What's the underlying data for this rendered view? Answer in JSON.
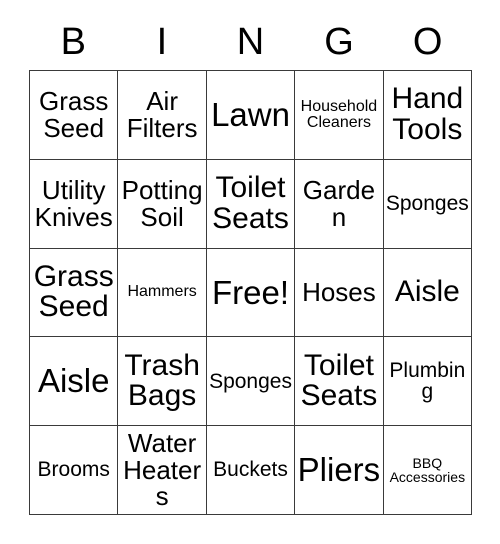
{
  "card": {
    "header_letters": [
      "B",
      "I",
      "N",
      "G",
      "O"
    ],
    "rows": [
      [
        {
          "text": "Grass Seed",
          "size": "md"
        },
        {
          "text": "Air Filters",
          "size": "md"
        },
        {
          "text": "Lawn",
          "size": "xl"
        },
        {
          "text": "Household Cleaners",
          "size": "xs"
        },
        {
          "text": "Hand Tools",
          "size": "lg"
        }
      ],
      [
        {
          "text": "Utility Knives",
          "size": "md"
        },
        {
          "text": "Potting Soil",
          "size": "md"
        },
        {
          "text": "Toilet Seats",
          "size": "lg"
        },
        {
          "text": "Garden",
          "size": "md"
        },
        {
          "text": "Sponges",
          "size": "sm"
        }
      ],
      [
        {
          "text": "Grass Seed",
          "size": "lg"
        },
        {
          "text": "Hammers",
          "size": "xs"
        },
        {
          "text": "Free!",
          "size": "xl"
        },
        {
          "text": "Hoses",
          "size": "md"
        },
        {
          "text": "Aisle",
          "size": "lg"
        }
      ],
      [
        {
          "text": "Aisle",
          "size": "xl"
        },
        {
          "text": "Trash Bags",
          "size": "lg"
        },
        {
          "text": "Sponges",
          "size": "sm"
        },
        {
          "text": "Toilet Seats",
          "size": "lg"
        },
        {
          "text": "Plumbing",
          "size": "sm"
        }
      ],
      [
        {
          "text": "Brooms",
          "size": "sm"
        },
        {
          "text": "Water Heaters",
          "size": "md"
        },
        {
          "text": "Buckets",
          "size": "sm"
        },
        {
          "text": "Pliers",
          "size": "xl"
        },
        {
          "text": "BBQ Accessories",
          "size": "xxs"
        }
      ]
    ]
  },
  "colors": {
    "border": "#3a3a3a",
    "text": "#000000",
    "background": "#ffffff"
  }
}
